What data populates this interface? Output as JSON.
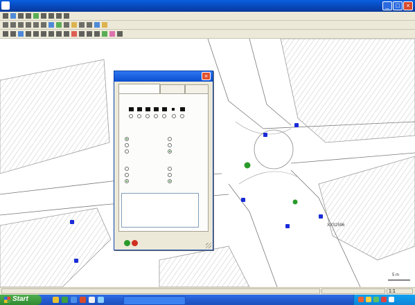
{
  "window": {
    "title": "",
    "minimize": "_",
    "maximize": "□",
    "close": "×"
  },
  "dialog": {
    "title": "",
    "close": "×",
    "tabs": [
      {
        "label": ""
      },
      {
        "label": ""
      },
      {
        "label": ""
      }
    ],
    "groups": [
      {
        "label": ""
      },
      {
        "label": ""
      },
      {
        "label": ""
      },
      {
        "label": ""
      },
      {
        "label": ""
      },
      {
        "label": ""
      }
    ],
    "options": [
      {
        "label": "",
        "checked": true
      },
      {
        "label": "",
        "checked": false
      },
      {
        "label": "",
        "checked": false
      },
      {
        "label": "",
        "checked": false
      },
      {
        "label": "",
        "checked": false
      },
      {
        "label": "",
        "checked": true
      },
      {
        "label": "",
        "checked": false
      },
      {
        "label": "",
        "checked": false
      },
      {
        "label": "",
        "checked": true
      },
      {
        "label": "",
        "checked": false
      },
      {
        "label": "",
        "checked": false
      },
      {
        "label": "",
        "checked": true
      }
    ],
    "link_text": "",
    "notes_value": ""
  },
  "map": {
    "labels": [
      "",
      "",
      "",
      "",
      "",
      "",
      "XXS2596",
      "",
      "",
      "",
      "5 m"
    ]
  },
  "status": {
    "left": "",
    "coords": "",
    "scale": "1:1"
  },
  "taskbar": {
    "start": "Start",
    "task": "",
    "clock": ""
  },
  "colors": {
    "marker": "#1a2bd8",
    "node_green": "#2a9a2a",
    "hatch": "#c8c8c8"
  }
}
